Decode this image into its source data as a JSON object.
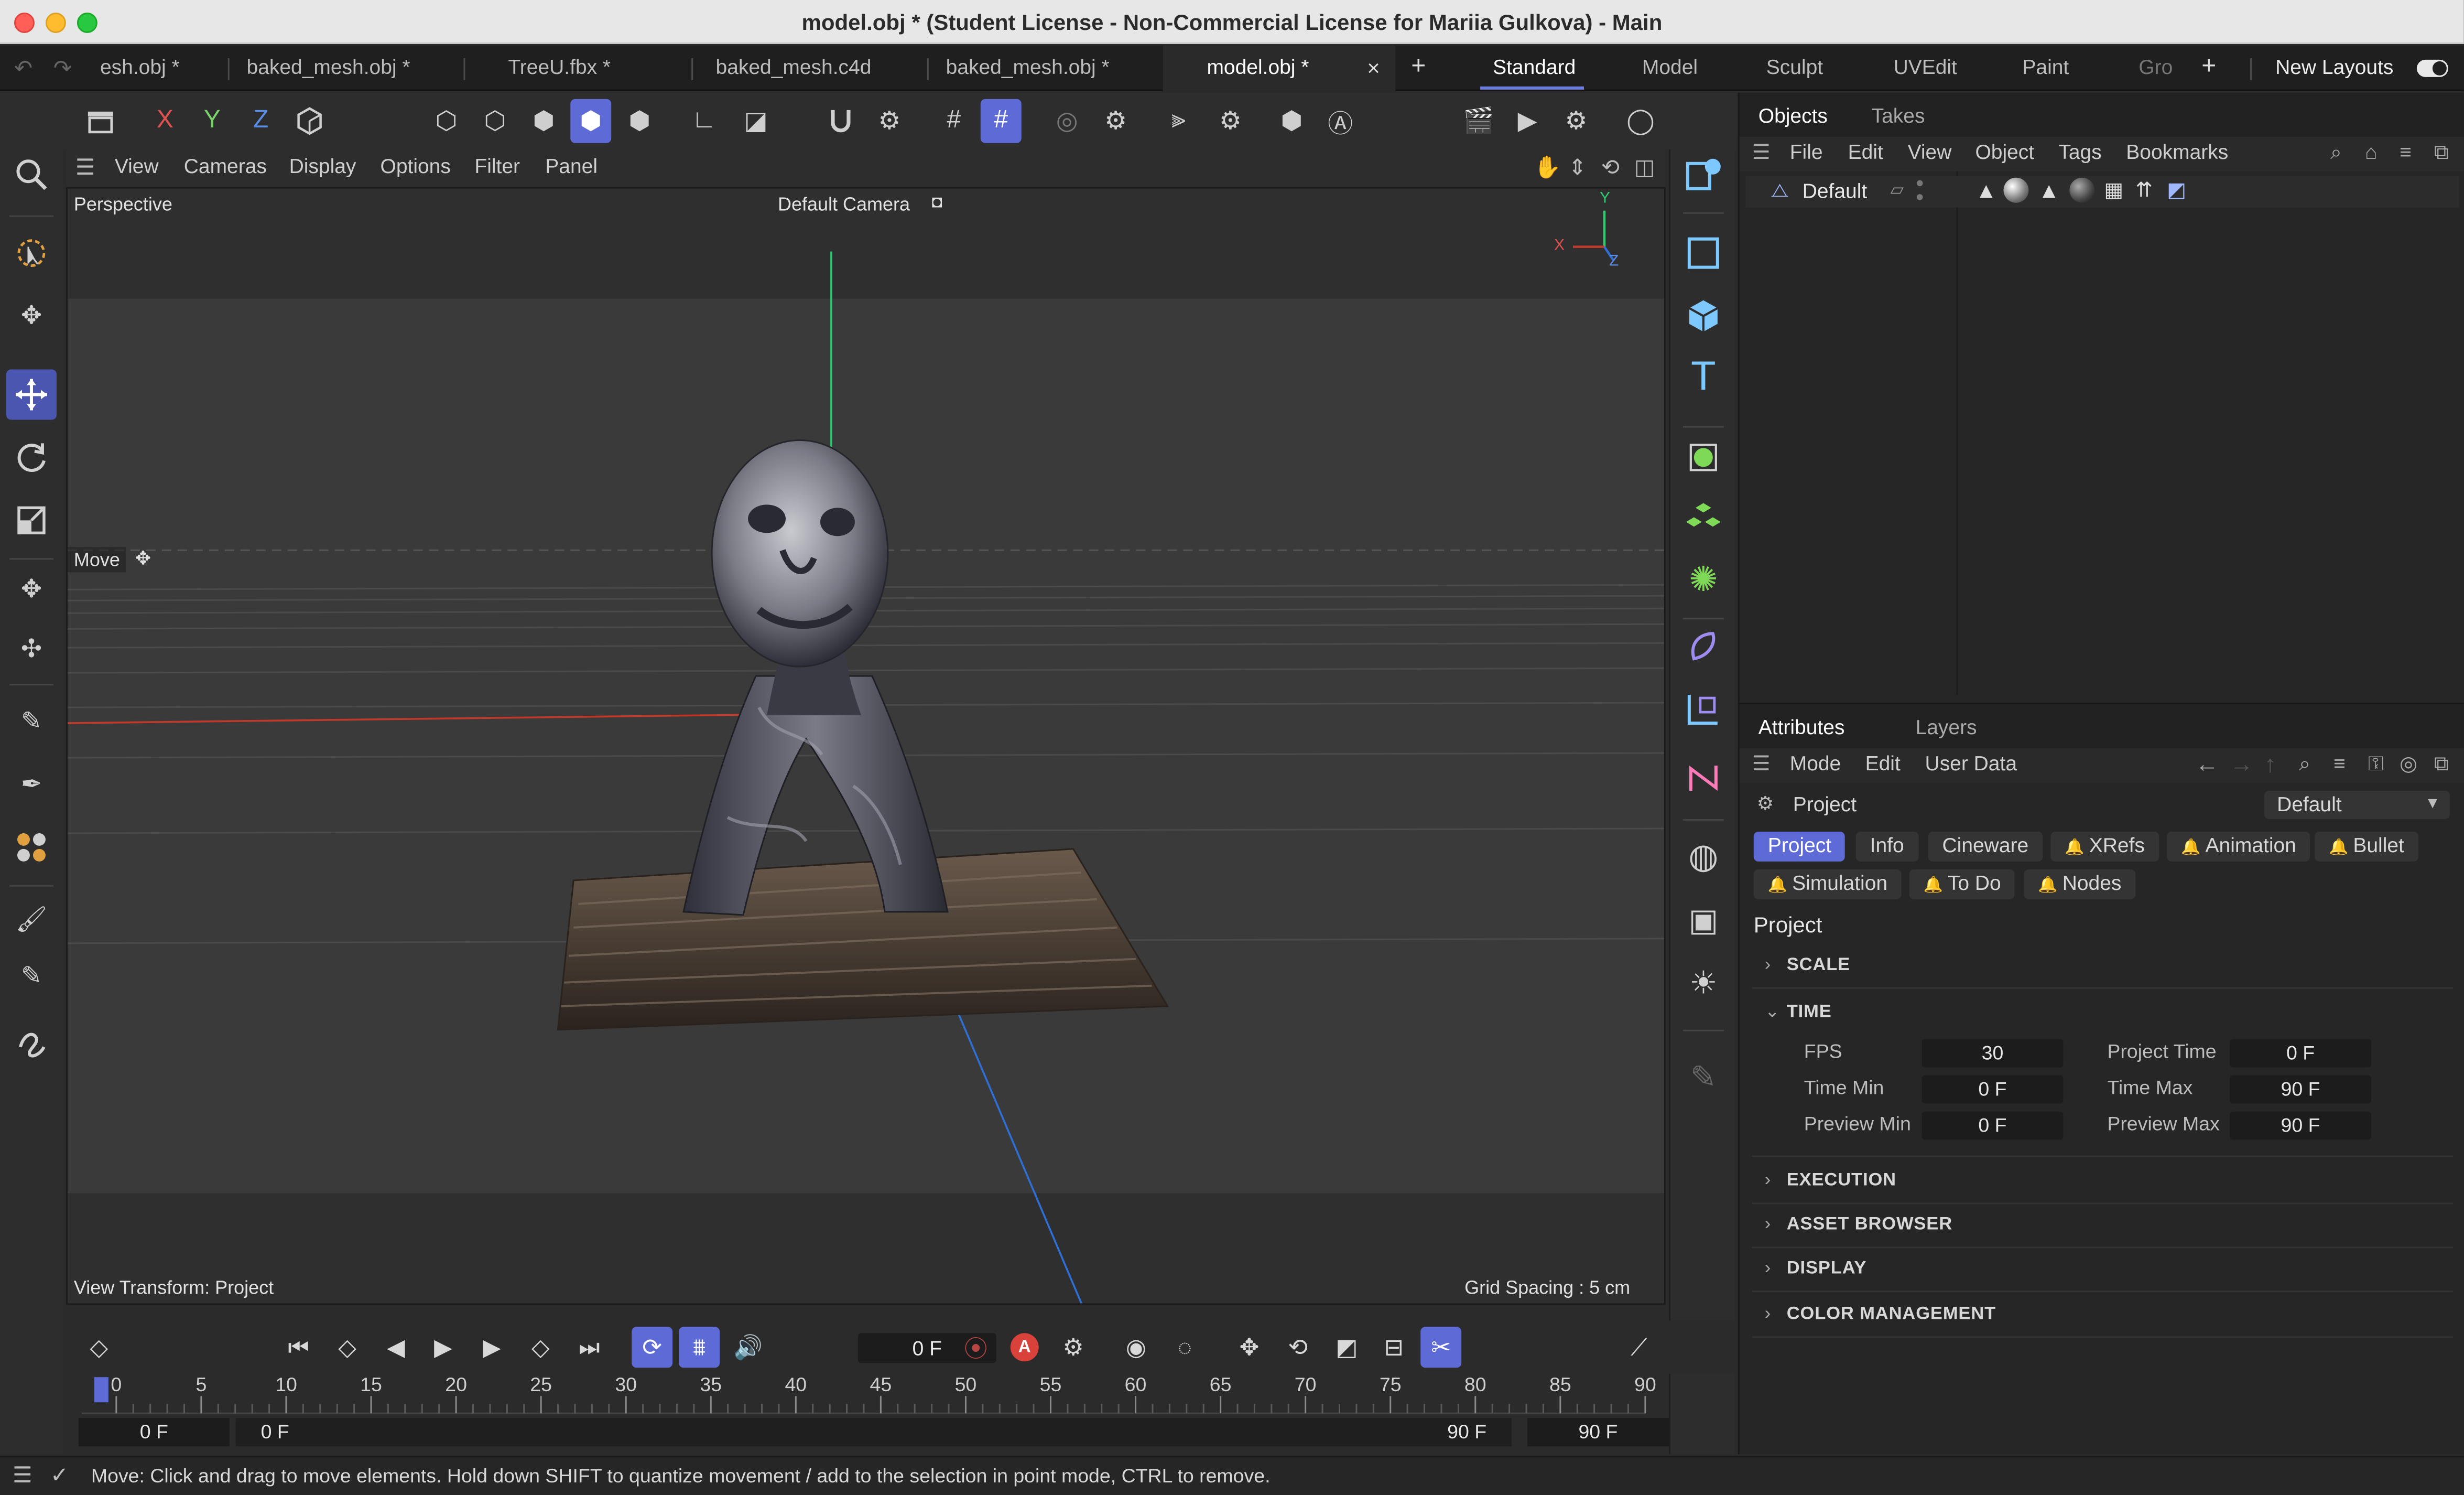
{
  "window": {
    "title": "model.obj * (Student License - Non-Commercial License for Mariia Gulkova) - Main"
  },
  "doc_tabs": [
    {
      "label": "esh.obj *",
      "active": false
    },
    {
      "label": "baked_mesh.obj *",
      "active": false
    },
    {
      "label": "TreeU.fbx *",
      "active": false
    },
    {
      "label": "baked_mesh.c4d",
      "active": false
    },
    {
      "label": "baked_mesh.obj *",
      "active": false
    },
    {
      "label": "model.obj *",
      "active": true
    }
  ],
  "layouts": {
    "tabs": [
      "Standard",
      "Model",
      "Sculpt",
      "UVEdit",
      "Paint",
      "Gro"
    ],
    "active": "Standard",
    "new_layouts": "New Layouts"
  },
  "toolbar": {
    "axis_x": "X",
    "axis_y": "Y",
    "axis_z": "Z"
  },
  "viewport": {
    "menu": [
      "View",
      "Cameras",
      "Display",
      "Options",
      "Filter",
      "Panel"
    ],
    "projection": "Perspective",
    "camera": "Default Camera",
    "tool_label": "Move",
    "view_transform": "View Transform: Project",
    "grid_spacing": "Grid Spacing : 5 cm",
    "axis_labels": {
      "x": "X",
      "y": "Y",
      "z": "Z"
    },
    "colors": {
      "x_axis": "#c0392b",
      "y_axis": "#2ecc71",
      "z_axis": "#2f6fd6"
    }
  },
  "objects_panel": {
    "tabs": [
      "Objects",
      "Takes"
    ],
    "menu": [
      "File",
      "Edit",
      "View",
      "Object",
      "Tags",
      "Bookmarks"
    ],
    "items": [
      {
        "name": "Default"
      }
    ]
  },
  "attributes_panel": {
    "tabs": [
      "Attributes",
      "Layers"
    ],
    "menu": [
      "Mode",
      "Edit",
      "User Data"
    ],
    "object_type": "Project",
    "preset": "Default",
    "chips_row1": [
      "Project",
      "Info",
      "Cineware",
      "XRefs",
      "Animation",
      "Bullet"
    ],
    "chips_row2": [
      "Simulation",
      "To Do",
      "Nodes"
    ],
    "heading": "Project",
    "sections": {
      "scale": "SCALE",
      "time": "TIME",
      "execution": "EXECUTION",
      "asset_browser": "ASSET BROWSER",
      "display": "DISPLAY",
      "color_management": "COLOR MANAGEMENT"
    },
    "time": {
      "fps_label": "FPS",
      "fps": "30",
      "project_time_label": "Project Time",
      "project_time": "0 F",
      "time_min_label": "Time Min",
      "time_min": "0 F",
      "time_max_label": "Time Max",
      "time_max": "90 F",
      "preview_min_label": "Preview Min",
      "preview_min": "0 F",
      "preview_max_label": "Preview Max",
      "preview_max": "90 F"
    },
    "accent": "#5e6bd6"
  },
  "timeline": {
    "current_frame": "0 F",
    "ticks": [
      "0",
      "5",
      "10",
      "15",
      "20",
      "25",
      "30",
      "35",
      "40",
      "45",
      "50",
      "55",
      "60",
      "65",
      "70",
      "75",
      "80",
      "85",
      "90"
    ],
    "range_start": "0 F",
    "preview_start": "0 F",
    "preview_end": "90 F",
    "range_end": "90 F",
    "key_button": "A"
  },
  "status": {
    "text": "Move: Click and drag to move elements. Hold down SHIFT to quantize movement / add to the selection in point mode, CTRL to remove."
  }
}
